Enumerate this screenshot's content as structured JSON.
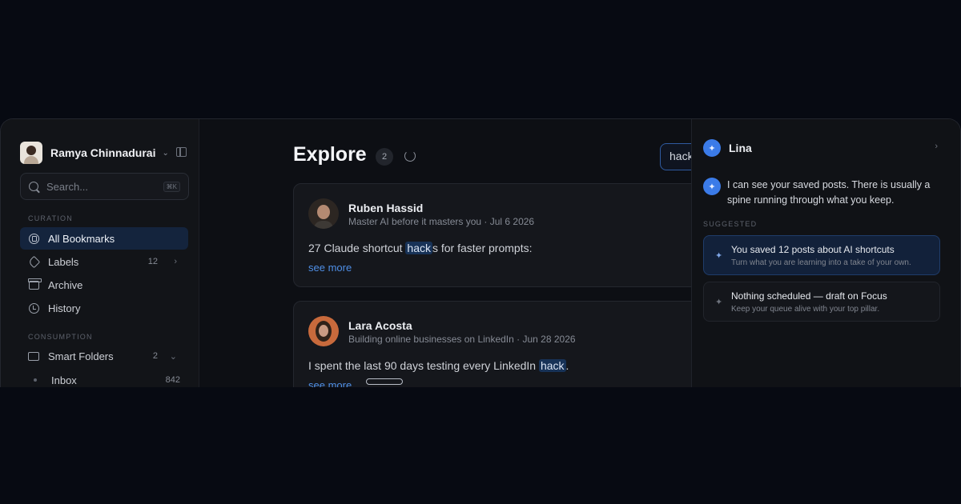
{
  "user": {
    "name": "Ramya Chinnadurai"
  },
  "search": {
    "placeholder": "Search...",
    "shortcut": "⌘K"
  },
  "sidebar": {
    "sections": [
      {
        "label": "CURATION"
      },
      {
        "label": "CONSUMPTION"
      }
    ],
    "items": [
      {
        "label": "All Bookmarks",
        "icon": "bookmark-icon"
      },
      {
        "label": "Labels",
        "count": "12",
        "icon": "tag-icon"
      },
      {
        "label": "Archive",
        "icon": "archive-icon"
      },
      {
        "label": "History",
        "icon": "clock-icon"
      },
      {
        "label": "Smart Folders",
        "count": "2",
        "icon": "folder-icon"
      },
      {
        "label": "Inbox",
        "count": "842"
      }
    ]
  },
  "main": {
    "title": "Explore",
    "count": "2",
    "search_value": "hack",
    "posts": [
      {
        "author": "Ruben Hassid",
        "subtitle": "Master AI before it masters you · Jul 6 2026",
        "text_before": "27 Claude shortcut ",
        "highlight": "hack",
        "text_after": "s for faster prompts:",
        "see_more": "see more"
      },
      {
        "author": "Lara Acosta",
        "subtitle": "Building online businesses on LinkedIn · Jun 28 2026",
        "text_before": "I spent the last 90 days testing every LinkedIn ",
        "highlight": "hack",
        "text_after": ".",
        "see_more": "see more"
      }
    ]
  },
  "assistant": {
    "name": "Lina",
    "message": "I can see your saved posts. There is usually a spine running through what you keep.",
    "suggested_label": "SUGGESTED",
    "suggestions": [
      {
        "title": "You saved 12 posts about AI shortcuts",
        "subtitle": "Turn what you are learning into a take of your own."
      },
      {
        "title": "Nothing scheduled — draft on Focus",
        "subtitle": "Keep your queue alive with your top pillar."
      }
    ]
  },
  "colors": {
    "accent": "#3b7be8",
    "highlight": "#173257",
    "link": "#4f8fe6"
  }
}
